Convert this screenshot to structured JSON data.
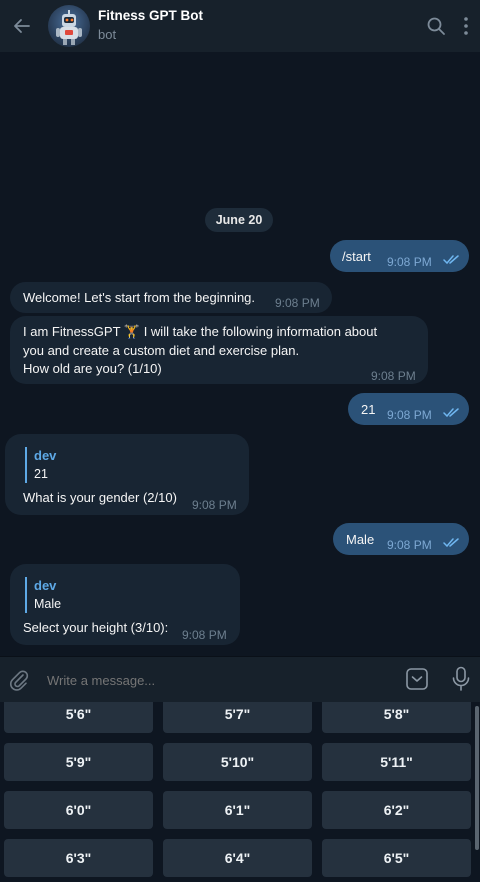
{
  "header": {
    "title": "Fitness GPT Bot",
    "subtitle": "bot",
    "icons": [
      "back-arrow-icon",
      "search-icon",
      "more-vertical-icon"
    ]
  },
  "chat": {
    "date": "June 20",
    "messages": [
      {
        "direction": "out",
        "text": "/start",
        "time": "9:08 PM",
        "read": true
      },
      {
        "direction": "in",
        "text": "Welcome! Let's start from the beginning.",
        "time": "9:08 PM"
      },
      {
        "direction": "in",
        "line1": "I am FitnessGPT 🏋 I will take the following information about",
        "line2": "you and create a custom diet and exercise plan.",
        "line3": "How old are you? (1/10)",
        "time": "9:08 PM"
      },
      {
        "direction": "out",
        "text": "21",
        "time": "9:08 PM",
        "read": true
      },
      {
        "direction": "in",
        "reply_name": "dev",
        "reply_text": "21",
        "text": "What is your gender (2/10)",
        "time": "9:08 PM"
      },
      {
        "direction": "out",
        "text": "Male",
        "time": "9:08 PM",
        "read": true
      },
      {
        "direction": "in",
        "reply_name": "dev",
        "reply_text": "Male",
        "text": "Select your height (3/10):",
        "time": "9:08 PM"
      }
    ]
  },
  "input": {
    "placeholder": "Write a message...",
    "icons": [
      "attach-icon",
      "keyboard-toggle-icon",
      "microphone-icon"
    ]
  },
  "keyboard": {
    "rows": [
      [
        "5'6\"",
        "5'7\"",
        "5'8\""
      ],
      [
        "5'9\"",
        "5'10\"",
        "5'11\""
      ],
      [
        "6'0\"",
        "6'1\"",
        "6'2\""
      ],
      [
        "6'3\"",
        "6'4\"",
        "6'5\""
      ]
    ]
  },
  "colors": {
    "background": "#0e1621",
    "header": "#17212b",
    "incoming_bubble": "#182533",
    "outgoing_bubble": "#2b5278",
    "accent": "#5ea9e6",
    "keyboard_button": "#25313e"
  }
}
